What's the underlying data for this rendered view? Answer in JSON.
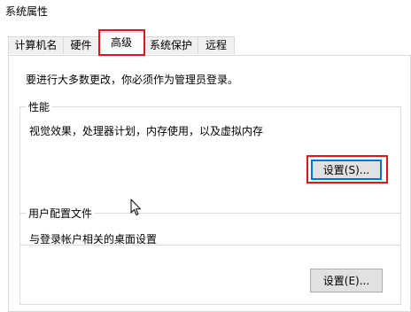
{
  "window": {
    "title": "系统属性"
  },
  "tabs": [
    {
      "label": "计算机名"
    },
    {
      "label": "硬件"
    },
    {
      "label": "高级"
    },
    {
      "label": "系统保护"
    },
    {
      "label": "远程"
    }
  ],
  "active_tab": "高级",
  "admin_notice": "要进行大多数更改，你必须作为管理员登录。",
  "performance": {
    "legend": "性能",
    "description": "视觉效果，处理器计划，内存使用，以及虚拟内存",
    "settings_button": "设置(S)..."
  },
  "user_profiles": {
    "legend": "用户配置文件",
    "description": "与登录帐户相关的桌面设置",
    "settings_button": "设置(E)..."
  },
  "colors": {
    "highlight": "#e5141b",
    "focus": "#0078d7"
  }
}
